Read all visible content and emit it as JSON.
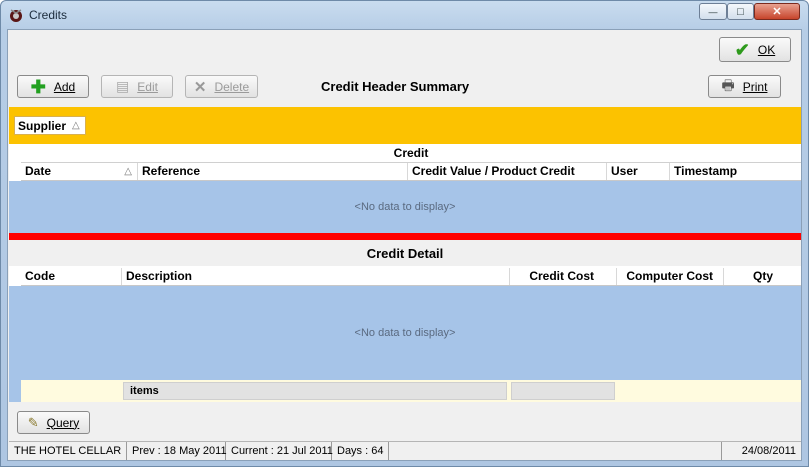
{
  "window": {
    "title": "Credits",
    "minimize": "—",
    "maximize": "□",
    "close": "✕"
  },
  "toolbar": {
    "ok_label": "OK",
    "add_label": "Add",
    "edit_label": "Edit",
    "delete_label": "Delete",
    "print_label": "Print",
    "header_title": "Credit Header Summary"
  },
  "group_bar": {
    "chip_label": "Supplier",
    "chip_sort": "△"
  },
  "header_grid": {
    "band_label": "Credit",
    "columns": [
      "Date",
      "Reference",
      "Credit Value / Product Credit",
      "User",
      "Timestamp"
    ],
    "date_sort": "△",
    "empty_text": "<No data to display>"
  },
  "detail": {
    "title": "Credit Detail",
    "columns": [
      "Code",
      "Description",
      "Credit Cost",
      "Computer Cost",
      "Qty"
    ],
    "empty_text": "<No data to display>",
    "footer_items_label": "items"
  },
  "query_label": "Query",
  "status": {
    "company": "THE HOTEL  CELLAR",
    "prev": "Prev : 18 May 2011",
    "current": "Current : 21 Jul 2011",
    "days": "Days : 64",
    "date": "24/08/2011"
  },
  "colors": {
    "group_bar": "#fcc200",
    "grid_body": "#a6c4e8",
    "separator": "#ff0000",
    "footer_row": "#fffbdf"
  }
}
